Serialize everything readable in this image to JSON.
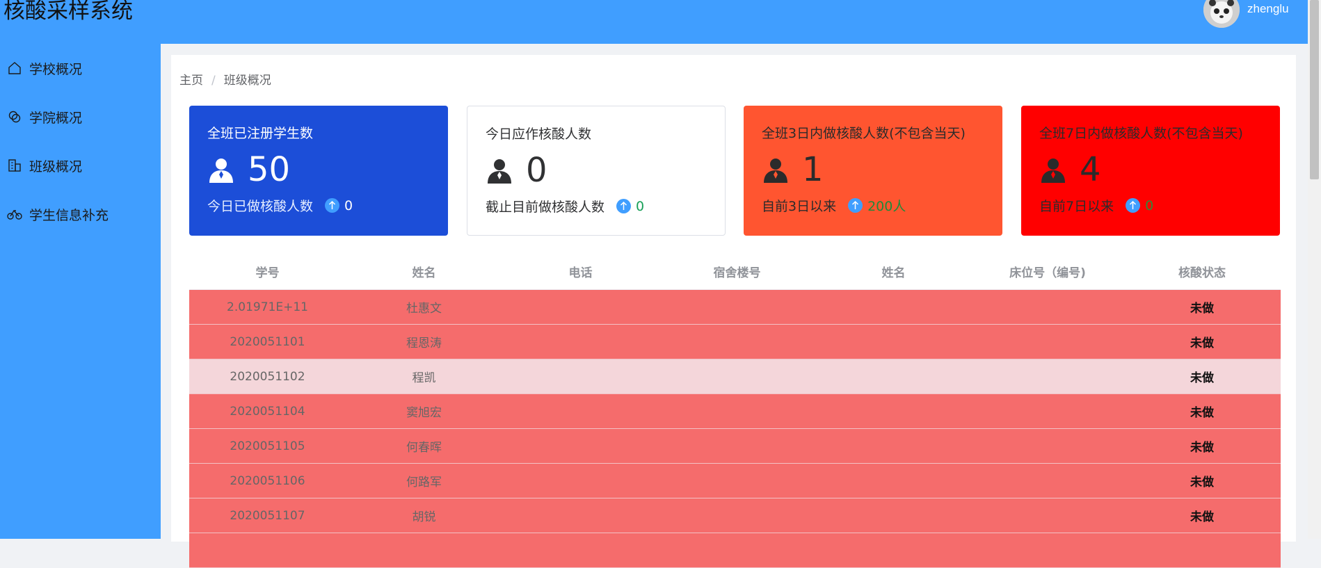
{
  "app": {
    "title": "核酸采样系统",
    "username": "zhenglu"
  },
  "sidebar": {
    "items": [
      {
        "label": "学校概况",
        "icon": "home-icon"
      },
      {
        "label": "学院概况",
        "icon": "chain-icon"
      },
      {
        "label": "班级概况",
        "icon": "building-icon"
      },
      {
        "label": "学生信息补充",
        "icon": "bicycle-icon"
      }
    ]
  },
  "breadcrumb": {
    "home": "主页",
    "separator": "/",
    "current": "班级概况"
  },
  "cards": [
    {
      "title": "全班已注册学生数",
      "value": "50",
      "sub_label": "今日已做核酸人数",
      "sub_value": "0",
      "bg": "#1c4ed8",
      "title_color": "#ffffff",
      "value_color": "#ffffff",
      "sub_color": "#e6eeff",
      "sub_value_color": "#ffffff"
    },
    {
      "title": "今日应作核酸人数",
      "value": "0",
      "sub_label": "截止目前做核酸人数",
      "sub_value": "0",
      "bg": "#ffffff",
      "title_color": "#303133",
      "value_color": "#303133",
      "sub_color": "#303133",
      "sub_value_color": "#18a058"
    },
    {
      "title": "全班3日内做核酸人数(不包含当天)",
      "value": "1",
      "sub_label": "自前3日以来",
      "sub_value": "200人",
      "bg": "#ff5530",
      "title_color": "#2b2b2b",
      "value_color": "#2b2b2b",
      "sub_color": "#2b2b2b",
      "sub_value_color": "#1f8a3a"
    },
    {
      "title": "全班7日内做核酸人数(不包含当天)",
      "value": "4",
      "sub_label": "自前7日以来",
      "sub_value": "0",
      "bg": "#ff0000",
      "title_color": "#2b2b2b",
      "value_color": "#2b2b2b",
      "sub_color": "#2b2b2b",
      "sub_value_color": "#2d8a3a"
    }
  ],
  "table": {
    "headers": [
      "学号",
      "姓名",
      "电话",
      "宿舍楼号",
      "姓名",
      "床位号（编号)",
      "核酸状态"
    ],
    "rows": [
      {
        "id": "2.01971E+11",
        "name": "杜惠文",
        "phone": "",
        "dorm": "",
        "name2": "",
        "bed": "",
        "status": "未做",
        "bg": "#f56c6c"
      },
      {
        "id": "2020051101",
        "name": "程恩涛",
        "phone": "",
        "dorm": "",
        "name2": "",
        "bed": "",
        "status": "未做",
        "bg": "#f56c6c"
      },
      {
        "id": "2020051102",
        "name": "程凯",
        "phone": "",
        "dorm": "",
        "name2": "",
        "bed": "",
        "status": "未做",
        "bg": "#f4d6da"
      },
      {
        "id": "2020051104",
        "name": "窦旭宏",
        "phone": "",
        "dorm": "",
        "name2": "",
        "bed": "",
        "status": "未做",
        "bg": "#f56c6c"
      },
      {
        "id": "2020051105",
        "name": "何春晖",
        "phone": "",
        "dorm": "",
        "name2": "",
        "bed": "",
        "status": "未做",
        "bg": "#f56c6c"
      },
      {
        "id": "2020051106",
        "name": "何路军",
        "phone": "",
        "dorm": "",
        "name2": "",
        "bed": "",
        "status": "未做",
        "bg": "#f56c6c"
      },
      {
        "id": "2020051107",
        "name": "胡锐",
        "phone": "",
        "dorm": "",
        "name2": "",
        "bed": "",
        "status": "未做",
        "bg": "#f56c6c"
      },
      {
        "id": "",
        "name": "",
        "phone": "",
        "dorm": "",
        "name2": "",
        "bed": "",
        "status": "",
        "bg": "#f56c6c"
      }
    ]
  }
}
